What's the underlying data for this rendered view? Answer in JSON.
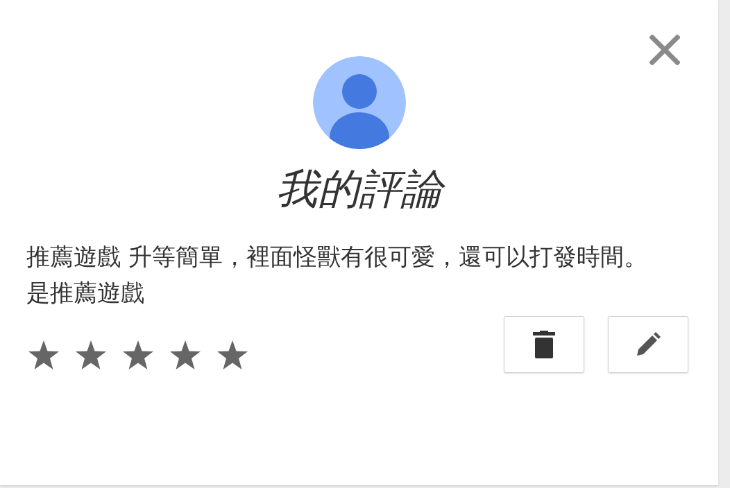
{
  "dialog": {
    "title": "我的評論",
    "review": "推薦遊戲 升等簡單，裡面怪獸有很可愛，還可以打發時間。是推薦遊戲",
    "stars": 5
  }
}
